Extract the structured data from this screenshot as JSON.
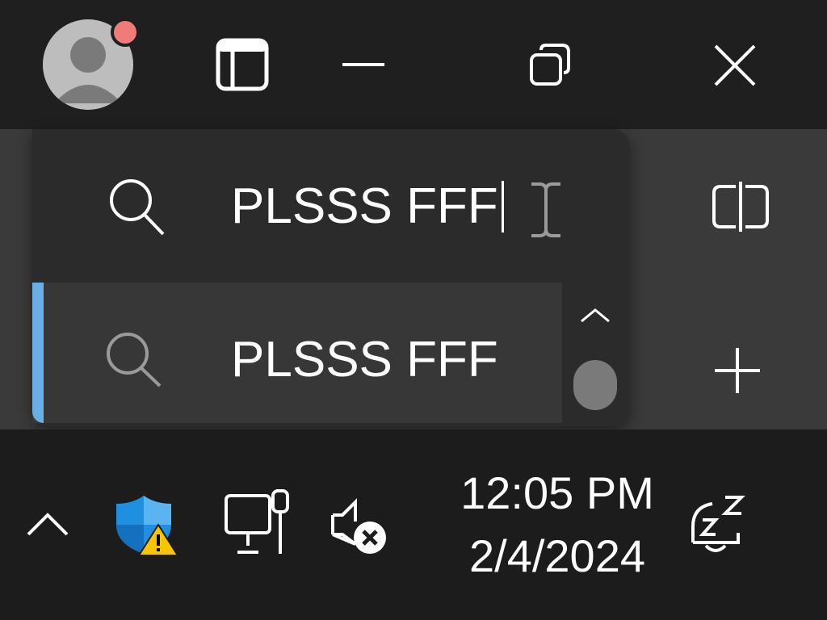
{
  "search": {
    "query": "PLSSS FFF",
    "suggestions": [
      {
        "label": "PLSSS FFF"
      }
    ]
  },
  "taskbar": {
    "time": "12:05 PM",
    "date": "2/4/2024"
  },
  "colors": {
    "titlebar": "#1f1f1f",
    "popup": "#2b2b2b",
    "selected_row": "#373737",
    "accent": "#6aaee6",
    "notification_badge": "#f07b7b",
    "taskbar": "#1c1c1c"
  },
  "icons": {
    "profile": "avatar-icon",
    "sidebar": "sidebar-toggle-icon",
    "minimize": "minimize-icon",
    "restore": "restore-icon",
    "close": "close-icon",
    "search": "search-icon",
    "split": "split-screen-icon",
    "new_tab": "plus-icon",
    "tray_overflow": "chevron-up-icon",
    "security": "windows-security-warning-icon",
    "network": "network-wired-icon",
    "volume": "volume-muted-icon",
    "notifications": "notifications-snooze-icon"
  }
}
